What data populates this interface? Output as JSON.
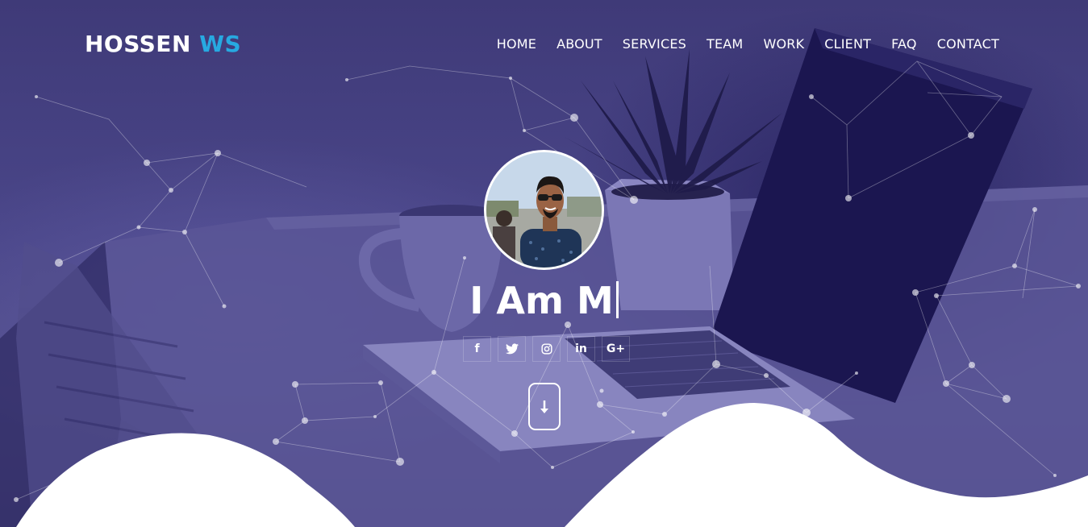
{
  "brand": {
    "name": "HOSSEN",
    "accent": "WS"
  },
  "nav": {
    "items": [
      "HOME",
      "ABOUT",
      "SERVICES",
      "TEAM",
      "WORK",
      "CLIENT",
      "FAQ",
      "CONTACT"
    ]
  },
  "hero": {
    "headline": "I Am M"
  },
  "social": {
    "facebook": "f",
    "instagram": "◎",
    "linkedin": "in",
    "google_plus": "G+"
  },
  "colors": {
    "overlay": "#4a4585",
    "accent": "#27a9e1",
    "text": "#ffffff"
  },
  "icons": [
    "facebook-icon",
    "twitter-icon",
    "instagram-icon",
    "linkedin-icon",
    "google-plus-icon",
    "arrow-down-icon"
  ]
}
